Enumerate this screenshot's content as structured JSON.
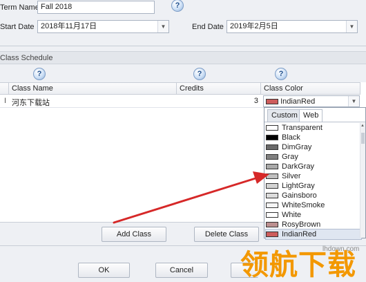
{
  "form": {
    "term_label": "Term Name",
    "term_value": "Fall 2018",
    "start_label": "Start Date",
    "start_value": "2018年11月17日",
    "end_label": "End Date",
    "end_value": "2019年2月5日",
    "help_glyph": "?"
  },
  "schedule": {
    "title": "Class Schedule",
    "columns": [
      "Class Name",
      "Credits",
      "Class Color"
    ],
    "row": {
      "name": "河东下载站",
      "credits": "3",
      "color": "IndianRed",
      "cursor_glyph": "I"
    }
  },
  "color_popup": {
    "tabs": [
      "Custom",
      "Web"
    ],
    "active_tab": "Web",
    "colors": [
      {
        "name": "Transparent",
        "hex": "#ffffff"
      },
      {
        "name": "Black",
        "hex": "#000000"
      },
      {
        "name": "DimGray",
        "hex": "#696969"
      },
      {
        "name": "Gray",
        "hex": "#808080"
      },
      {
        "name": "DarkGray",
        "hex": "#a9a9a9"
      },
      {
        "name": "Silver",
        "hex": "#c0c0c0"
      },
      {
        "name": "LightGray",
        "hex": "#d3d3d3"
      },
      {
        "name": "Gainsboro",
        "hex": "#dcdcdc"
      },
      {
        "name": "WhiteSmoke",
        "hex": "#f5f5f5"
      },
      {
        "name": "White",
        "hex": "#ffffff"
      },
      {
        "name": "RosyBrown",
        "hex": "#bc8f8f"
      },
      {
        "name": "IndianRed",
        "hex": "#cd5c5c"
      }
    ],
    "selected": "IndianRed"
  },
  "buttons": {
    "add_class": "Add Class",
    "delete_class": "Delete Class",
    "ok": "OK",
    "cancel": "Cancel"
  },
  "watermark": {
    "site": "lhdown.com",
    "brand": "领航下载"
  },
  "colors": {
    "arrow": "#d62828",
    "watermark_orange": "#f39800"
  }
}
